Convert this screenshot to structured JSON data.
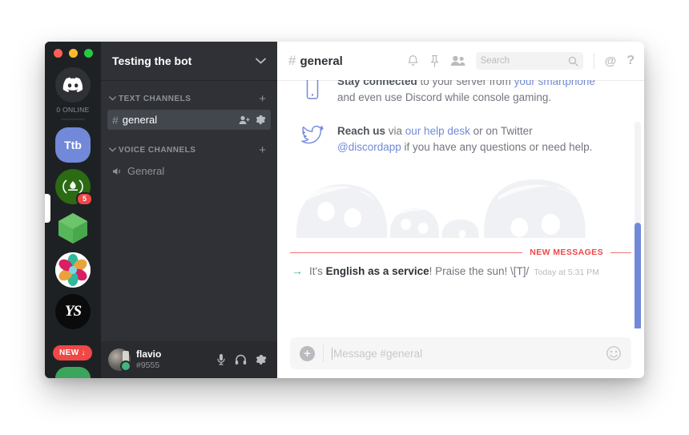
{
  "window": {
    "traffic_lights": [
      "close",
      "minimize",
      "maximize"
    ]
  },
  "server_rail": {
    "home_label": "0 ONLINE",
    "home_icon": "discord-clyde-icon",
    "servers": [
      {
        "id": "ttb",
        "label": "Ttb",
        "type": "initials",
        "active": true,
        "color": "#7289da"
      },
      {
        "id": "flame",
        "label": "",
        "type": "flame",
        "active": false,
        "color": "#2a6b14",
        "badge": "5"
      },
      {
        "id": "hex",
        "label": "",
        "type": "hexagon",
        "active": false,
        "color": "#52b14c"
      },
      {
        "id": "pinwheel",
        "label": "",
        "type": "pinwheel",
        "active": false,
        "color": "#ffffff"
      },
      {
        "id": "script",
        "label": "YS",
        "type": "script",
        "active": false,
        "color": "#0b0b0b"
      }
    ],
    "new_badge": {
      "label": "NEW",
      "arrow": "↓",
      "color": "#f04747"
    }
  },
  "sidebar": {
    "guild_name": "Testing the bot",
    "categories": [
      {
        "name": "TEXT CHANNELS",
        "add_label": "+",
        "channels": [
          {
            "name": "general",
            "type": "text",
            "active": true,
            "actions": [
              "add-member-icon",
              "gear-icon"
            ]
          }
        ]
      },
      {
        "name": "VOICE CHANNELS",
        "add_label": "+",
        "channels": [
          {
            "name": "General",
            "type": "voice",
            "active": false,
            "actions": []
          }
        ]
      }
    ],
    "user": {
      "username": "flavio",
      "discriminator": "#9555",
      "status": "online",
      "status_color": "#43b581",
      "actions": [
        "microphone-icon",
        "headphones-icon",
        "gear-icon"
      ]
    }
  },
  "channel_header": {
    "hash": "#",
    "name": "general",
    "icons": [
      "bell-icon",
      "pin-icon",
      "members-icon"
    ],
    "search_placeholder": "Search",
    "mentions_label": "@",
    "help_label": "?"
  },
  "messages": {
    "welcome": [
      {
        "icon": "smartphone-icon",
        "bold": "Stay connected",
        "rest": " to your server from ",
        "link": "your smartphone",
        "line2": "and even use Discord while console gaming."
      },
      {
        "icon": "twitter-bird-icon",
        "bold": "Reach us",
        "rest": " via ",
        "link": "our help desk",
        "tail": " or on Twitter",
        "link2": "@discordapp",
        "line2_tail": " if you have any questions or need help."
      }
    ],
    "new_messages_label": "NEW MESSAGES",
    "new_messages_color": "#f04747",
    "system_message": {
      "arrow": "→",
      "prefix": "It's ",
      "bold": "English as a service",
      "suffix": "! Praise the sun! \\[T]/",
      "timestamp": "Today at 5:31 PM"
    }
  },
  "composer": {
    "add_label": "+",
    "placeholder": "Message #general",
    "emoji_icon": "emoji-icon"
  },
  "colors": {
    "blurple": "#7289da",
    "danger": "#f04747",
    "online": "#43b581",
    "rail_bg": "#1e2124",
    "sidebar_bg": "#2f3136"
  }
}
